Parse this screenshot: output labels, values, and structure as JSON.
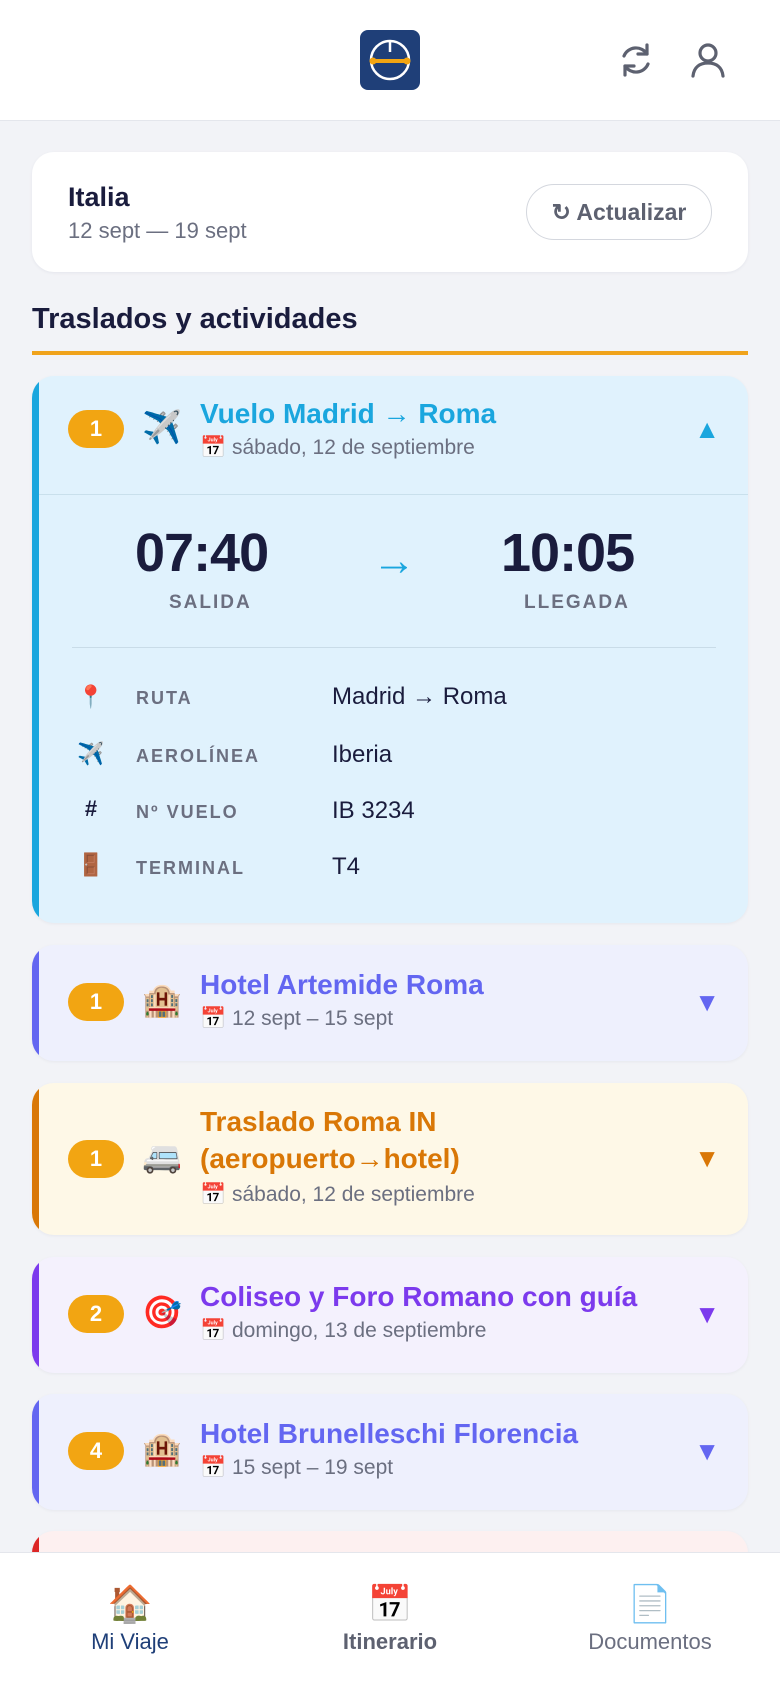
{
  "header": {
    "logo_icon": "compass-logo-icon",
    "sync_icon": "sync-icon",
    "profile_icon": "user-icon"
  },
  "trip": {
    "name": "Italia",
    "dates": "12 sept — 19 sept",
    "refresh_label": "↻ Actualizar"
  },
  "section": {
    "title": "Traslados y actividades"
  },
  "items": [
    {
      "badge": "1",
      "emoji": "✈️",
      "title": "Vuelo Madrid → Roma",
      "subtitle": "📅 sábado, 12 de septiembre",
      "caret": "▲",
      "expanded": true,
      "accent": "#1aa6de",
      "background": "#e0f2fd",
      "details": {
        "departure_time": "07:40",
        "departure_label": "SALIDA",
        "arrival_time": "10:05",
        "arrival_label": "LLEGADA",
        "arrow": "→",
        "rows": [
          {
            "icon": "📍",
            "label": "RUTA",
            "value": "Madrid → Roma"
          },
          {
            "icon": "✈️",
            "label": "AEROLÍNEA",
            "value": "Iberia"
          },
          {
            "icon": "#",
            "label": "Nº VUELO",
            "value": "IB 3234"
          },
          {
            "icon": "🚪",
            "label": "TERMINAL",
            "value": "T4"
          }
        ]
      }
    },
    {
      "badge": "1",
      "emoji": "🏨",
      "title": "Hotel Artemide Roma",
      "subtitle": "📅 12 sept – 15 sept",
      "caret": "▼",
      "accent": "#6366f1",
      "background": "#eef0fd"
    },
    {
      "badge": "1",
      "emoji": "🚐",
      "title_line1": "Traslado Roma IN",
      "title_line2": "(aeropuerto→hotel)",
      "subtitle": "📅 sábado, 12 de septiembre",
      "caret": "▼",
      "accent": "#d97706",
      "background": "#fef8e7"
    },
    {
      "badge": "2",
      "emoji": "🎯",
      "title": "Coliseo y Foro Romano con guía",
      "subtitle": "📅 domingo, 13 de septiembre",
      "caret": "▼",
      "accent": "#7c3aed",
      "background": "#f4f1fd"
    },
    {
      "badge": "4",
      "emoji": "🏨",
      "title": "Hotel Brunelleschi Florencia",
      "subtitle": "📅 15 sept – 19 sept",
      "caret": "▼",
      "accent": "#6366f1",
      "background": "#eef0fd"
    }
  ],
  "nav": [
    {
      "icon": "🏠",
      "label": "Mi Viaje",
      "active": true
    },
    {
      "icon": "📅",
      "label": "Itinerario",
      "bold": true
    },
    {
      "icon": "📄",
      "label": "Documentos"
    }
  ]
}
